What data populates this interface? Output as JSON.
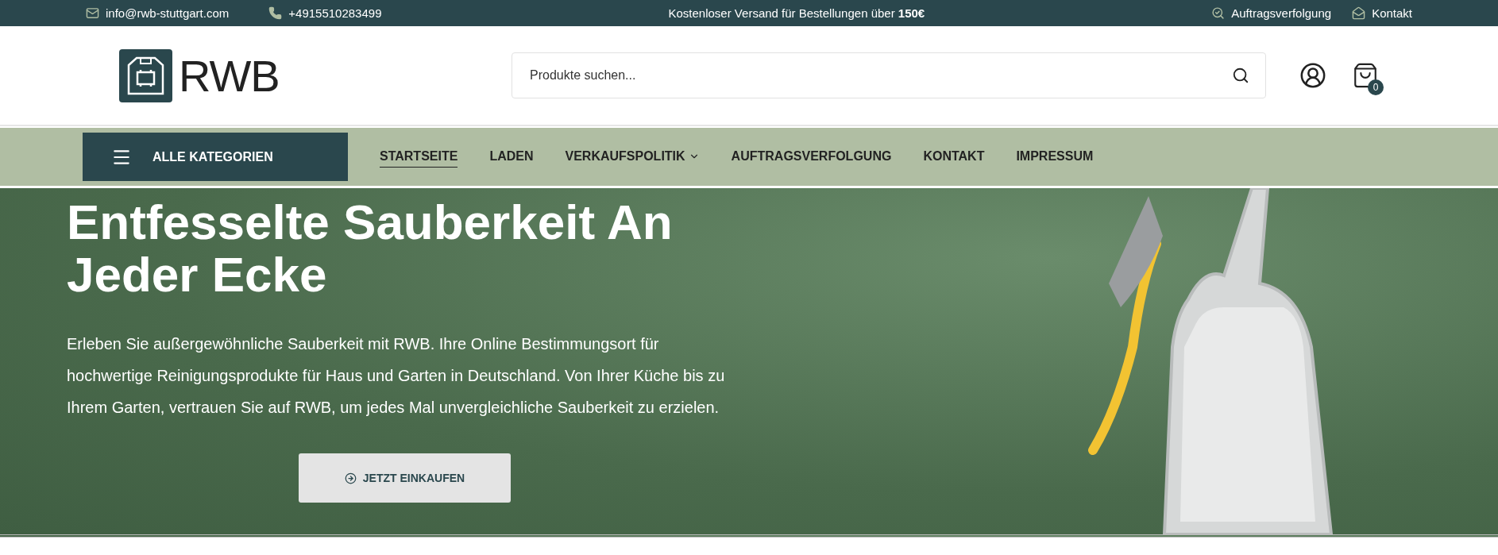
{
  "top_bar": {
    "email": "info@rwb-stuttgart.com",
    "phone": "+4915510283499",
    "shipping_notice": "Kostenloser Versand für Bestellungen über **150€**",
    "links": [
      {
        "kind": "tracking",
        "label": "Auftragsverfolgung"
      },
      {
        "kind": "contact",
        "label": "Kontakt"
      }
    ]
  },
  "header": {
    "logo_text": "RWB",
    "search": {
      "placeholder": "Produkte suchen..."
    },
    "cart_count": "0"
  },
  "nav": {
    "categories_button": "ALLE KATEGORIEN",
    "items": [
      {
        "label": "STARTSEITE",
        "selected": true,
        "dropdown": false
      },
      {
        "label": "LADEN",
        "selected": false,
        "dropdown": false
      },
      {
        "label": "VERKAUFSPOLITIK",
        "selected": false,
        "dropdown": true
      },
      {
        "label": "AUFTRAGSVERFOLGUNG",
        "selected": false,
        "dropdown": false
      },
      {
        "label": "KONTAKT",
        "selected": false,
        "dropdown": false
      },
      {
        "label": "IMPRESSUM",
        "selected": false,
        "dropdown": false
      }
    ]
  },
  "hero": {
    "title": "Entfesselte Sauberkeit An Jeder Ecke",
    "text": "Erleben Sie außergewöhnliche Sauberkeit mit RWB. Ihre Online Bestimmungsort für hochwertige Reinigungsprodukte für Haus und Garten in Deutschland. Von Ihrer Küche bis zu Ihrem Garten, vertrauen Sie auf RWB, um jedes Mal unvergleichliche Sauberkeit zu erzielen.",
    "button": "JETZT EINKAUFEN"
  }
}
